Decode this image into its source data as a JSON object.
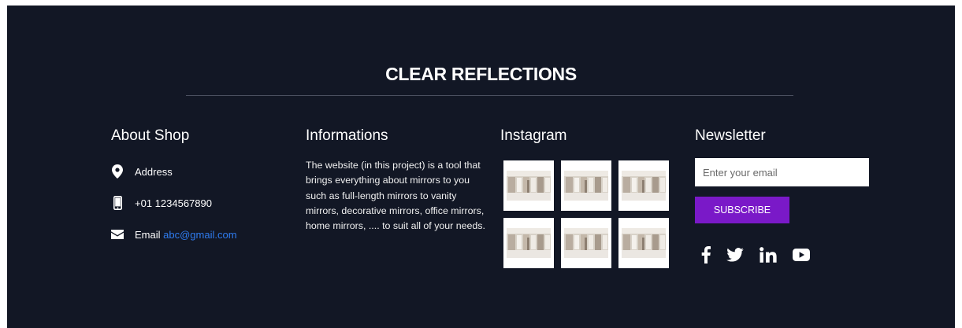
{
  "brand": {
    "title": "CLEAR REFLECTIONS"
  },
  "about": {
    "heading": "About Shop",
    "address": {
      "icon": "map-pin-icon",
      "label": "Address"
    },
    "phone": {
      "icon": "mobile-phone-icon",
      "label": "+01 1234567890"
    },
    "email": {
      "icon": "envelope-icon",
      "label": "Email",
      "address": "abc@gmail.com"
    }
  },
  "info": {
    "heading": "Informations",
    "text": "The website (in this project) is a tool that brings everything about mirrors to you such as full-length mirrors to vanity mirrors, decorative mirrors, office mirrors, home mirrors, .... to suit all of your needs."
  },
  "instagram": {
    "heading": "Instagram",
    "photo_count": 6,
    "thumbnail_icon": "showroom-photo"
  },
  "newsletter": {
    "heading": "Newsletter",
    "placeholder": "Enter your email",
    "button_label": "SUBSCRIBE",
    "social": [
      "facebook-icon",
      "twitter-icon",
      "linkedin-icon",
      "youtube-icon"
    ]
  },
  "colors": {
    "background": "#121725",
    "accent": "#7a19c8",
    "link": "#2f7cf0",
    "text": "#ffffff"
  }
}
